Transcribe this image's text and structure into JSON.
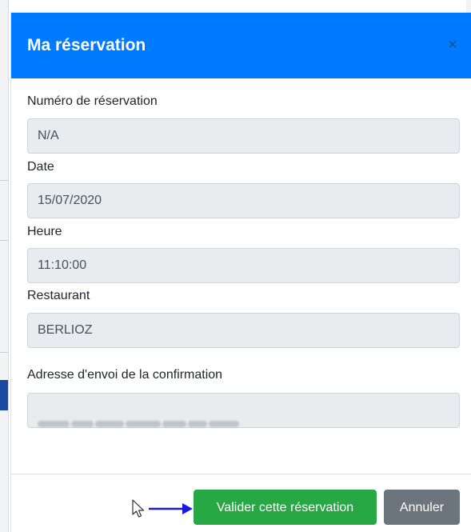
{
  "modal": {
    "title": "Ma réservation",
    "close_label": "×"
  },
  "fields": {
    "reservation_number": {
      "label": "Numéro de réservation",
      "value": "N/A"
    },
    "date": {
      "label": "Date",
      "value": "15/07/2020"
    },
    "time": {
      "label": "Heure",
      "value": "11:10:00"
    },
    "restaurant": {
      "label": "Restaurant",
      "value": "BERLIOZ"
    },
    "confirmation_email": {
      "label": "Adresse d'envoi de la confirmation"
    }
  },
  "buttons": {
    "validate_label": "Valider cette réservation",
    "cancel_label": "Annuler"
  },
  "colors": {
    "header": "#007bff",
    "validate": "#28a745",
    "cancel": "#6c757d",
    "annotation_arrow": "#1a1adb"
  }
}
